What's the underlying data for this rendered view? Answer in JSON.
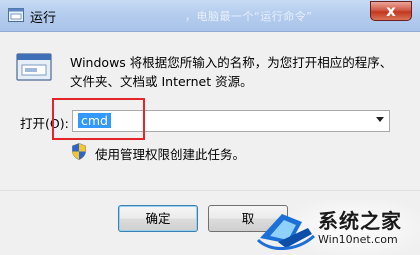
{
  "window": {
    "title": "运行",
    "background_title_text": "，电脑最一个“运行命令”",
    "close_symbol": "x"
  },
  "dialog": {
    "description_line1": "Windows 将根据您所输入的名称，为您打开相应的程序、",
    "description_line2": "文件夹、文档或 Internet 资源。",
    "open_label": "打开(O):",
    "input_value": "cmd",
    "admin_note": "使用管理权限创建此任务。"
  },
  "buttons": {
    "ok": "确定",
    "cancel": "取"
  },
  "watermark": {
    "brand": "系统之家",
    "url": "Win10net.com"
  },
  "colors": {
    "highlight_box": "#e5252a",
    "selection": "#3399ff",
    "close_button": "#c3381f"
  },
  "icons": [
    "run-app-icon",
    "program-window-icon",
    "uac-shield-icon",
    "dropdown-arrow-icon",
    "watermark-logo-icon"
  ]
}
